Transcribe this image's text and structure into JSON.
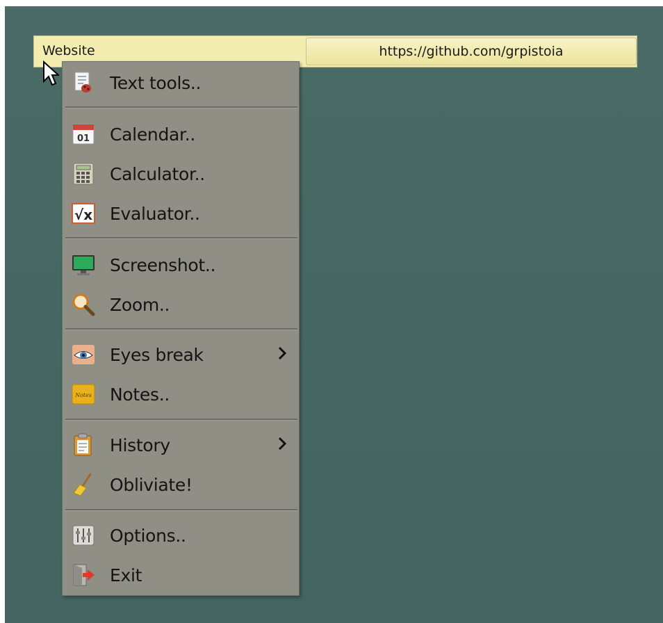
{
  "infobar": {
    "label": "Website",
    "value": "https://github.com/grpistoia"
  },
  "menu": {
    "items": [
      {
        "label": "Text tools..",
        "icon": "text-tools-icon"
      },
      {
        "label": "Calendar..",
        "icon": "calendar-icon",
        "icon_text": "01"
      },
      {
        "label": "Calculator..",
        "icon": "calculator-icon"
      },
      {
        "label": "Evaluator..",
        "icon": "evaluator-icon",
        "icon_text": "√x"
      },
      {
        "label": "Screenshot..",
        "icon": "screenshot-icon"
      },
      {
        "label": "Zoom..",
        "icon": "zoom-icon"
      },
      {
        "label": "Eyes break",
        "icon": "eye-icon",
        "submenu": true
      },
      {
        "label": "Notes..",
        "icon": "notes-icon",
        "icon_text": "Notes"
      },
      {
        "label": "History",
        "icon": "clipboard-icon",
        "submenu": true
      },
      {
        "label": "Obliviate!",
        "icon": "broom-icon"
      },
      {
        "label": "Options..",
        "icon": "sliders-icon"
      },
      {
        "label": "Exit",
        "icon": "exit-icon"
      }
    ]
  },
  "colors": {
    "desktop": "#466763",
    "menu_bg": "#8f8f86",
    "infobar_bg": "#f3eeb0"
  }
}
